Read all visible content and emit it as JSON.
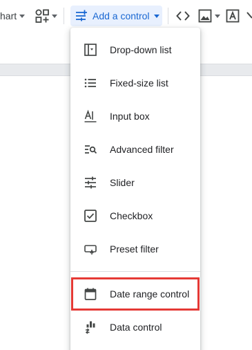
{
  "toolbar": {
    "chart_label": "hart",
    "add_control_label": "Add a control"
  },
  "menu": {
    "items": [
      {
        "label": "Drop-down list",
        "icon": "dropdown-list-icon"
      },
      {
        "label": "Fixed-size list",
        "icon": "fixed-list-icon"
      },
      {
        "label": "Input box",
        "icon": "input-box-icon"
      },
      {
        "label": "Advanced filter",
        "icon": "advanced-filter-icon"
      },
      {
        "label": "Slider",
        "icon": "slider-icon"
      },
      {
        "label": "Checkbox",
        "icon": "checkbox-icon"
      },
      {
        "label": "Preset filter",
        "icon": "preset-filter-icon"
      },
      {
        "label": "Date range control",
        "icon": "calendar-icon"
      },
      {
        "label": "Data control",
        "icon": "data-control-icon"
      }
    ]
  },
  "colors": {
    "accent": "#1967d2",
    "accent_bg": "#e8f0fe",
    "highlight": "#e53935",
    "icon": "#444746",
    "text": "#202124"
  }
}
